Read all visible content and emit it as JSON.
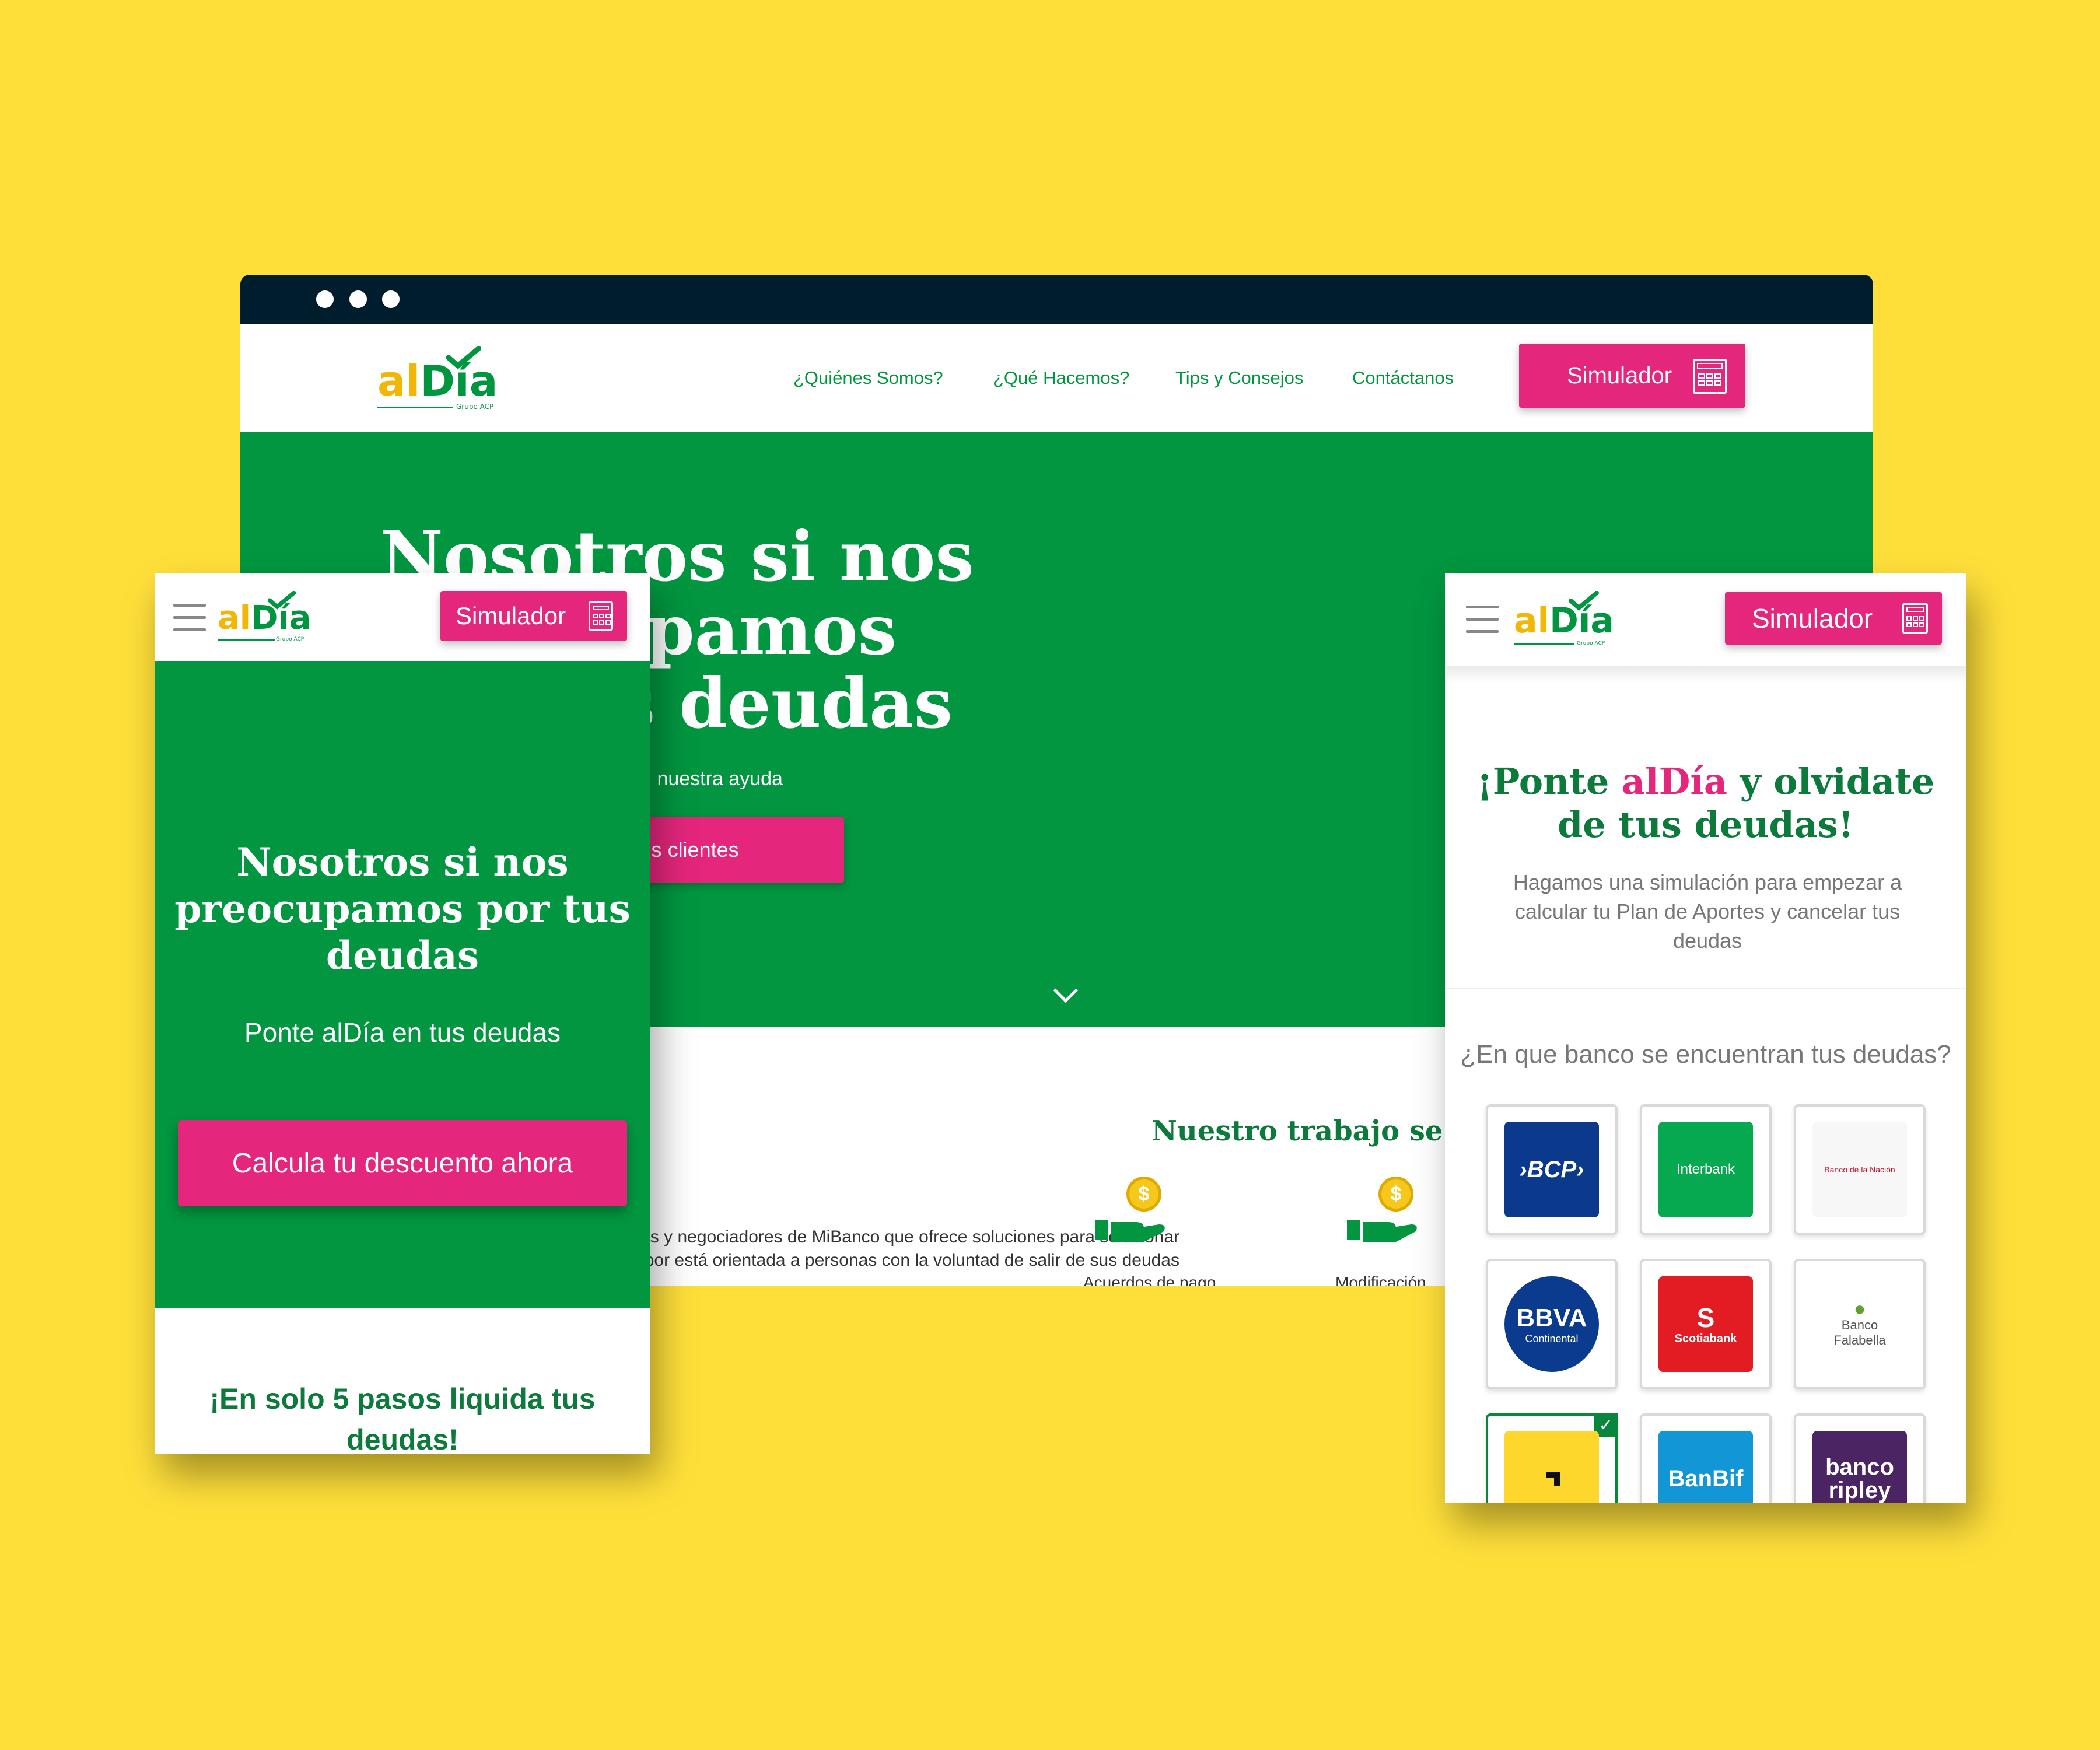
{
  "brand": {
    "logo_al": "al",
    "logo_dia": "Día",
    "logo_tag": "Grupo ACP",
    "colors": {
      "background": "#FEDF3A",
      "green": "#029640",
      "pink": "#E4267C",
      "dark_green": "#0B7A3B",
      "yellow": "#F2B705",
      "chrome": "#001D2D"
    }
  },
  "desktop": {
    "nav": {
      "links": [
        "¿Quiénes Somos?",
        "¿Qué Hacemos?",
        "Tips y Consejos",
        "Contáctanos"
      ],
      "simulator_label": "Simulador",
      "simulator_icon": "calculator-icon"
    },
    "hero": {
      "title": "Nosotros si nos preocupamos por tus deudas",
      "subtitle": "Ponte alDía en tus deudas con nuestra ayuda",
      "cta": "Conoce a nuestros clientes",
      "scroll_icon": "chevron-down-icon"
    },
    "section": {
      "heading": "Nuestro trabajo se centra en",
      "paragraph": "Somos una empresa de asesores y negociadores de MiBanco que ofrece soluciones para solucionar deudas atrasadas Nuestra labor está orientada a personas con la voluntad de salir de sus deudas",
      "features": [
        {
          "icon": "money-hand-icon",
          "caption": "Acuerdos de pago"
        },
        {
          "icon": "money-hand-icon",
          "caption": "Modificación"
        }
      ]
    }
  },
  "mobile_home": {
    "simulator_label": "Simulador",
    "hero_title": "Nosotros si nos preocupamos por tus deudas",
    "hero_subtitle": "Ponte alDía en tus deudas",
    "cta": "Calcula tu descuento ahora",
    "steps_title": "¡En solo 5 pasos liquida tus deudas!"
  },
  "mobile_simulator": {
    "simulator_label": "Simulador",
    "title_prefix": "¡Ponte ",
    "title_brand": "alDía",
    "title_suffix": " y olvidate de tus deudas!",
    "description": "Hagamos una simulación para empezar a calcular tu Plan de Aportes y cancelar tus deudas",
    "question": "¿En que banco se encuentran tus deudas?",
    "banks": [
      {
        "name": "BCP",
        "label": "›BCP›",
        "color": "#0B3A8C",
        "selected": false
      },
      {
        "name": "Interbank",
        "label": "Interbank",
        "color": "#07A950",
        "selected": false
      },
      {
        "name": "Banco de la Nación",
        "label": "Banco de la Nación",
        "color": "#C8102E",
        "selected": false
      },
      {
        "name": "BBVA Continental",
        "label": "BBVA",
        "sublabel": "Continental",
        "color": "#0A3B8E",
        "selected": false
      },
      {
        "name": "Scotiabank",
        "label": "Scotiabank",
        "color": "#E31B23",
        "selected": false
      },
      {
        "name": "Banco Falabella",
        "label": "Banco",
        "sublabel": "Falabella",
        "color": "#5EA32B",
        "selected": false
      },
      {
        "name": "Banco Pichincha",
        "label": "",
        "color": "#FDD72B",
        "selected": true
      },
      {
        "name": "BanBif",
        "label": "BanBif",
        "color": "#1296D5",
        "selected": false
      },
      {
        "name": "Banco Ripley",
        "label": "banco",
        "sublabel": "ripley",
        "color": "#4B2463",
        "selected": false
      }
    ]
  }
}
